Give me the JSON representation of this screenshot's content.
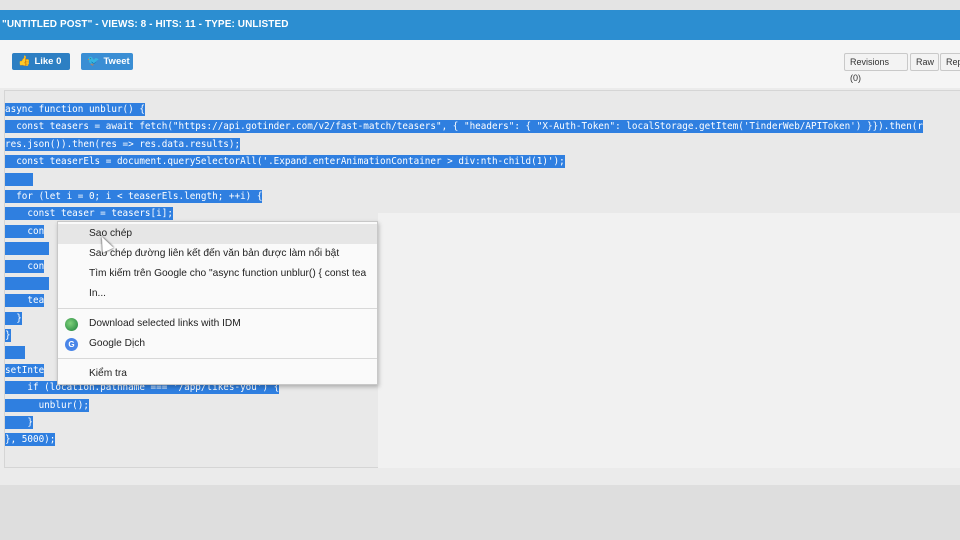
{
  "header": {
    "title": "\"UNTITLED POST\" - VIEWS: 8 - HITS: 11 - TYPE: UNLISTED"
  },
  "toolbar": {
    "like_label": "Like 0",
    "tweet_label": "Tweet",
    "revisions_label": "Revisions (0)",
    "raw_label": "Raw",
    "rep_label": "Rep"
  },
  "code": {
    "lines": [
      "async function unblur() {",
      "  const teasers = await fetch(\"https://api.gotinder.com/v2/fast-match/teasers\", { \"headers\": { \"X-Auth-Token\": localStorage.getItem('TinderWeb/APIToken') }}).then(r",
      "res.json()).then(res => res.data.results);",
      "  const teaserEls = document.querySelectorAll('.Expand.enterAnimationContainer > div:nth-child(1)');",
      "",
      "  for (let i = 0; i < teaserEls.length; ++i) {",
      "    const teaser = teasers[i];",
      "    con",
      "",
      "    con",
      "",
      "    tea",
      "  }",
      "}",
      "",
      "setInte",
      "    if (location.pathname === '/app/likes-you') {",
      "      unblur();",
      "    }",
      "}, 5000);"
    ]
  },
  "context_menu": {
    "copy": "Sao chép",
    "copy_link": "Sao chép đường liên kết đến văn bản được làm nổi bật",
    "search_google": "Tìm kiếm trên Google cho \"async function unblur() {    const tea",
    "print": "In...",
    "idm": "Download selected links with IDM",
    "translate": "Google Dịch",
    "inspect": "Kiểm tra"
  },
  "colors": {
    "header_bg": "#2c8ed1",
    "selection": "#2f7fe0"
  }
}
